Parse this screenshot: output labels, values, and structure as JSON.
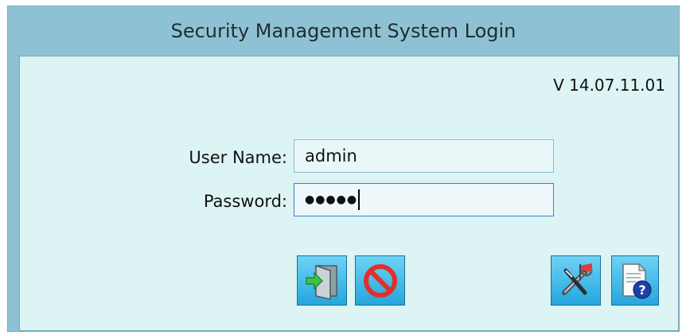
{
  "window": {
    "title": "Security Management System Login"
  },
  "version": "V 14.07.11.01",
  "form": {
    "username_label": "User Name:",
    "username_value": "admin",
    "password_label": "Password:",
    "password_masked": "●●●●●"
  },
  "buttons": {
    "login_icon": "door-enter-icon",
    "cancel_icon": "no-entry-icon",
    "settings_icon": "tools-settings-icon",
    "help_icon": "document-help-icon"
  },
  "colors": {
    "title_bar": "#8fc1d4",
    "client_bg": "#dcf4f4",
    "button_blue": "#24a6dd",
    "cancel_red": "#e0302a",
    "help_blue": "#1e40a8"
  }
}
